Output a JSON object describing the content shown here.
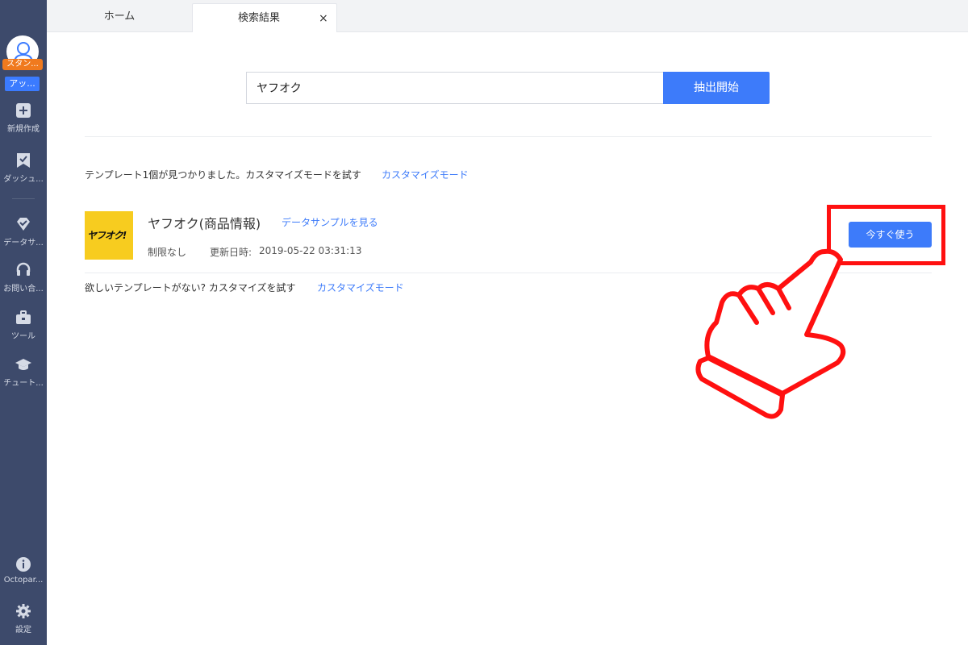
{
  "sidebar": {
    "plan_badge": "スタン...",
    "upgrade_badge": "アッ...",
    "items": [
      {
        "label": "新規作成",
        "icon": "plus-square-icon"
      },
      {
        "label": "ダッシュ...",
        "icon": "dashboard-bookmark-icon"
      },
      {
        "label": "データサ...",
        "icon": "data-service-icon"
      },
      {
        "label": "お問い合...",
        "icon": "headset-icon"
      },
      {
        "label": "ツール",
        "icon": "toolbox-icon"
      },
      {
        "label": "チュート...",
        "icon": "graduation-cap-icon"
      },
      {
        "label": "Octopar...",
        "icon": "info-icon"
      },
      {
        "label": "設定",
        "icon": "gear-icon"
      }
    ]
  },
  "tabs": {
    "home": "ホーム",
    "search_results": "検索結果",
    "close_glyph": "×"
  },
  "search": {
    "value": "ヤフオク",
    "button_label": "抽出開始"
  },
  "results": {
    "found_text": "テンプレート1個が見つかりました。カスタマイズモードを試す",
    "custom_mode_link": "カスタマイズモード",
    "template": {
      "thumb_text": "ヤフオク!",
      "name": "ヤフオク(商品情報)",
      "sample_link": "データサンプルを見る",
      "limit": "制限なし",
      "updated_label": "更新日時:",
      "updated_value": "2019-05-22 03:31:13",
      "use_button": "今すぐ使う"
    },
    "missing_text": "欲しいテンプレートがない? カスタマイズを試す",
    "missing_link": "カスタマイズモード"
  },
  "colors": {
    "sidebar_bg": "#3d4a6b",
    "accent": "#3d7bfa",
    "highlight": "#ff1010",
    "plan_badge": "#f07a1e"
  }
}
